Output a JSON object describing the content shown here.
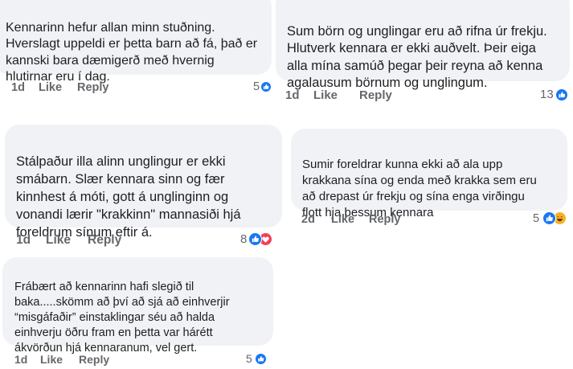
{
  "comments": [
    {
      "text": "Kennarinn hefur allan minn stuðning.\nHverslagt uppeldi er þetta barn að fá, það er\nkannski bara dæmigerð með hvernig\nhlutirnar eru í dag.",
      "age": "1d",
      "like": "Like",
      "reply": "Reply",
      "reaction_count": "5",
      "reactions": [
        "like-icon"
      ]
    },
    {
      "text": "Sum börn og unglingar eru að rifna úr frekju.\nHlutverk kennara er ekki auðvelt. Þeir eiga\nalla mína samúð þegar þeir reyna að kenna\nagalausum börnum og unglingum.",
      "age": "1d",
      "like": "Like",
      "reply": "Reply",
      "reaction_count": "13",
      "reactions": [
        "like-icon"
      ]
    },
    {
      "text": "Stálpaður illa alinn unglingur er ekki\nsmábarn. Slær kennara sinn og fær\nkinnhest á móti, gott á unglinginn og\nvonandi lærir \"krakkinn\" mannasiði hjá\nforeldrum sínum eftir á.",
      "age": "1d",
      "like": "Like",
      "reply": "Reply",
      "reaction_count": "8",
      "reactions": [
        "like-icon",
        "love-icon"
      ]
    },
    {
      "text": "Sumir foreldrar kunna ekki að ala upp\nkrakkana sína og enda með krakka sem eru\nað drepast úr frekju og sína enga virðingu\nflott hja þessum kennara",
      "age": "2d",
      "like": "Like",
      "reply": "Reply",
      "reaction_count": "5",
      "reactions": [
        "like-icon",
        "haha-icon"
      ]
    },
    {
      "text": "Frábært að kennarinn hafi slegið til\nbaka.....skömm að því að sjá að einhverjir\n“misgáfaðir” einstaklingar séu að halda\neinhverju öðru fram en þetta var hárétt\nákvörðun hjá kennaranum, vel gert.",
      "age": "1d",
      "like": "Like",
      "reply": "Reply",
      "reaction_count": "5",
      "reactions": [
        "like-icon"
      ]
    }
  ],
  "colors": {
    "bubble": "#f0f2f5",
    "text": "#1c1e21",
    "meta": "#65676b",
    "like": "#1877f2",
    "love": "#f33e58",
    "haha": "#f7b125"
  }
}
